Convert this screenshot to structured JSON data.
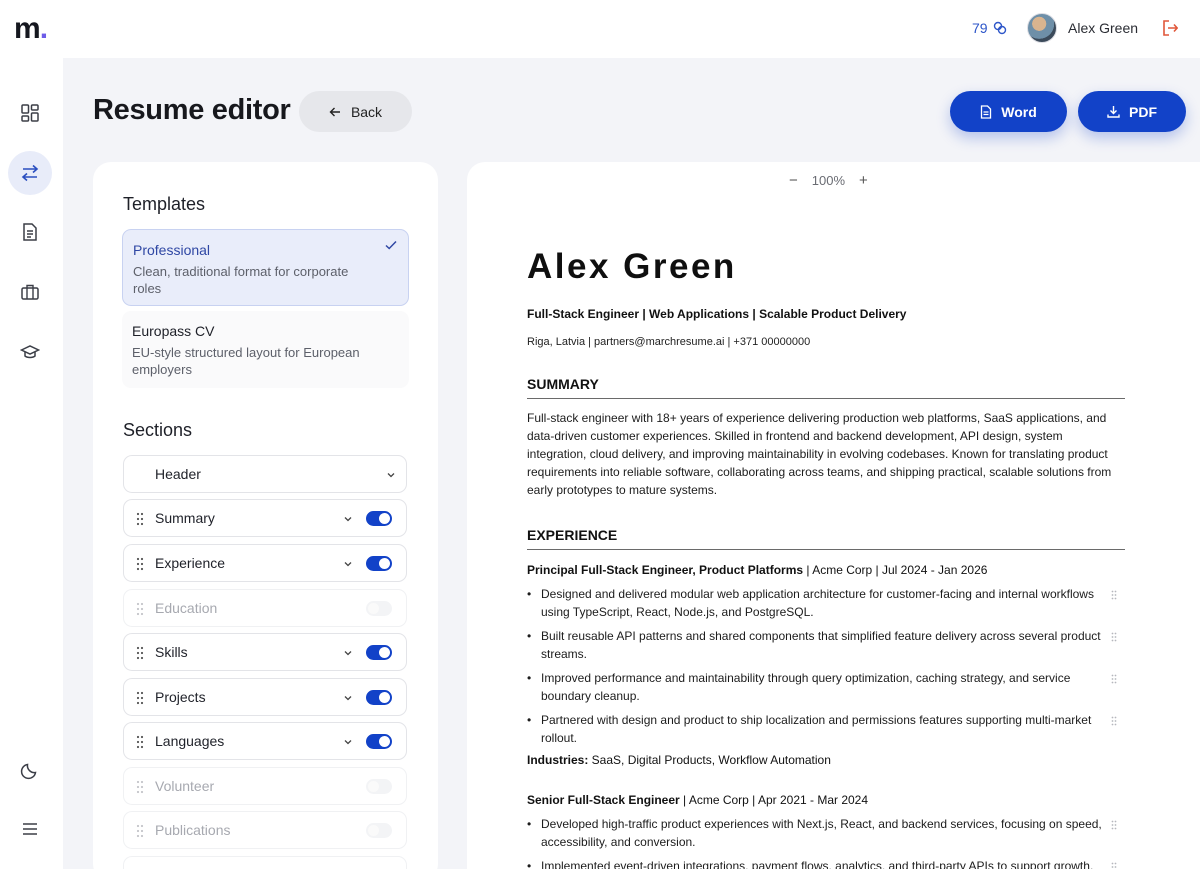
{
  "app": {
    "logo_letter": "m",
    "logo_dot": ".",
    "credits": "79",
    "user_name": "Alex Green"
  },
  "colors": {
    "accent": "#1242c8",
    "logo_dot": "#6d5ce8",
    "selected_template_bg": "#e9edfa",
    "logout_icon": "#e0573a"
  },
  "rail": [
    {
      "name": "dashboard-icon",
      "active": false
    },
    {
      "name": "swap-icon",
      "active": true
    },
    {
      "name": "document-icon",
      "active": false
    },
    {
      "name": "briefcase-icon",
      "active": false
    },
    {
      "name": "graduation-cap-icon",
      "active": false
    },
    {
      "name": "moon-icon",
      "active": false
    },
    {
      "name": "menu-icon",
      "active": false
    }
  ],
  "header": {
    "title": "Resume editor",
    "back_label": "Back",
    "word_label": "Word",
    "pdf_label": "PDF"
  },
  "templates": {
    "heading": "Templates",
    "items": [
      {
        "name": "Professional",
        "desc": "Clean, traditional format for corporate roles",
        "selected": true
      },
      {
        "name": "Europass CV",
        "desc": "EU-style structured layout for European employers",
        "selected": false
      }
    ]
  },
  "sections": {
    "heading": "Sections",
    "items": [
      {
        "label": "Header",
        "enabled": true,
        "toggle": false
      },
      {
        "label": "Summary",
        "enabled": true,
        "toggle": true
      },
      {
        "label": "Experience",
        "enabled": true,
        "toggle": true
      },
      {
        "label": "Education",
        "enabled": false,
        "toggle": true
      },
      {
        "label": "Skills",
        "enabled": true,
        "toggle": true
      },
      {
        "label": "Projects",
        "enabled": true,
        "toggle": true
      },
      {
        "label": "Languages",
        "enabled": true,
        "toggle": true
      },
      {
        "label": "Volunteer",
        "enabled": false,
        "toggle": true
      },
      {
        "label": "Publications",
        "enabled": false,
        "toggle": true
      }
    ]
  },
  "preview": {
    "zoom_minus": "−",
    "zoom_level": "100%",
    "zoom_plus": "+"
  },
  "resume": {
    "name": "Alex Green",
    "headline": "Full-Stack Engineer | Web Applications | Scalable Product Delivery",
    "contact": "Riga, Latvia | partners@marchresume.ai | +371 00000000",
    "summary_heading": "SUMMARY",
    "summary": "Full-stack engineer with 18+ years of experience delivering production web platforms, SaaS applications, and data-driven customer experiences. Skilled in frontend and backend development, API design, system integration, cloud delivery, and improving maintainability in evolving codebases. Known for translating product requirements into reliable software, collaborating across teams, and shipping practical, scalable solutions from early prototypes to mature systems.",
    "experience_heading": "EXPERIENCE",
    "jobs": [
      {
        "title": "Principal Full-Stack Engineer, Product Platforms",
        "meta": " | Acme Corp | Jul 2024 - Jan 2026",
        "bullets": [
          "Designed and delivered modular web application architecture for customer-facing and internal workflows using TypeScript, React, Node.js, and PostgreSQL.",
          "Built reusable API patterns and shared components that simplified feature delivery across several product streams.",
          "Improved performance and maintainability through query optimization, caching strategy, and service boundary cleanup.",
          "Partnered with design and product to ship localization and permissions features supporting multi-market rollout."
        ],
        "industries_label": "Industries:",
        "industries": " SaaS, Digital Products, Workflow Automation"
      },
      {
        "title": "Senior Full-Stack Engineer",
        "meta": " | Acme Corp | Apr 2021 - Mar 2024",
        "bullets": [
          "Developed high-traffic product experiences with Next.js, React, and backend services, focusing on speed, accessibility, and conversion.",
          "Implemented event-driven integrations, payment flows, analytics, and third-party APIs to support growth."
        ]
      }
    ]
  }
}
